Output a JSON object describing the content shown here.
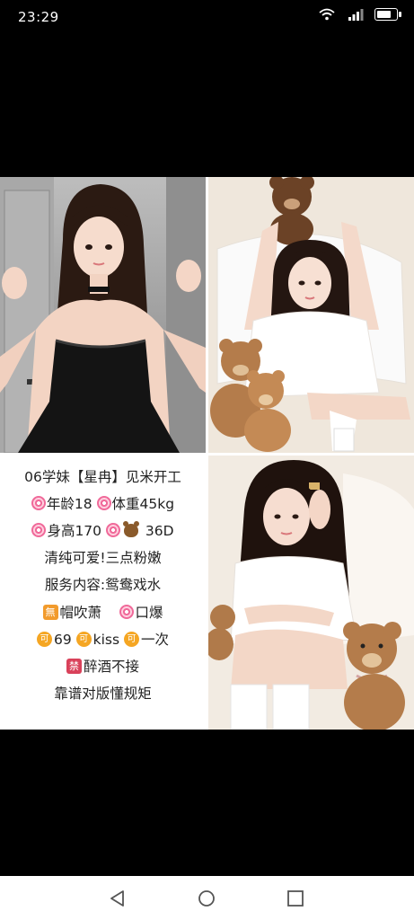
{
  "status_bar": {
    "time": "23:29",
    "icons": [
      "notification-dot-icon",
      "wifi-icon",
      "signal-icon",
      "battery-icon"
    ]
  },
  "collage": {
    "photos": [
      {
        "name": "photo-top-left",
        "subject": "woman in black strapless dress"
      },
      {
        "name": "photo-top-right",
        "subject": "woman in white tee with teddy bears"
      },
      {
        "name": "photo-bottom-right",
        "subject": "woman in white tee with teddy bear"
      }
    ],
    "text_lines": [
      {
        "parts": [
          {
            "type": "text",
            "value": "06学妹【星冉】见米开工"
          }
        ]
      },
      {
        "parts": [
          {
            "type": "lolly"
          },
          {
            "type": "text",
            "value": "年龄18 "
          },
          {
            "type": "lolly"
          },
          {
            "type": "text",
            "value": "体重45kg"
          }
        ]
      },
      {
        "parts": [
          {
            "type": "lolly"
          },
          {
            "type": "text",
            "value": "身高170 "
          },
          {
            "type": "lolly"
          },
          {
            "type": "bear"
          },
          {
            "type": "text",
            "value": " 36D"
          }
        ]
      },
      {
        "parts": [
          {
            "type": "text",
            "value": "清纯可爱!三点粉嫩"
          }
        ]
      },
      {
        "parts": [
          {
            "type": "text",
            "value": "服务内容:鸳鸯戏水"
          }
        ]
      },
      {
        "parts": [
          {
            "type": "sq",
            "value": "無"
          },
          {
            "type": "text",
            "value": "帽吹萧　 "
          },
          {
            "type": "lolly"
          },
          {
            "type": "text",
            "value": "口爆"
          }
        ]
      },
      {
        "parts": [
          {
            "type": "circ",
            "value": "可"
          },
          {
            "type": "text",
            "value": "69  "
          },
          {
            "type": "circ",
            "value": "可"
          },
          {
            "type": "text",
            "value": "kiss  "
          },
          {
            "type": "circ",
            "value": "可"
          },
          {
            "type": "text",
            "value": "一次"
          }
        ]
      },
      {
        "parts": [
          {
            "type": "sqred",
            "value": "禁"
          },
          {
            "type": "text",
            "value": "醉酒不接"
          }
        ]
      },
      {
        "parts": [
          {
            "type": "text",
            "value": "靠谱对版懂规矩"
          }
        ]
      }
    ]
  },
  "nav_bar": {
    "buttons": [
      {
        "name": "back-button",
        "icon": "back-triangle-icon"
      },
      {
        "name": "home-button",
        "icon": "home-circle-icon"
      },
      {
        "name": "recents-button",
        "icon": "recents-square-icon"
      }
    ]
  },
  "colors": {
    "background": "#000000",
    "panel": "#ffffff",
    "badge_orange": "#f29b2c",
    "badge_red": "#d9415a",
    "lollipop_pink": "#f06a9a"
  }
}
